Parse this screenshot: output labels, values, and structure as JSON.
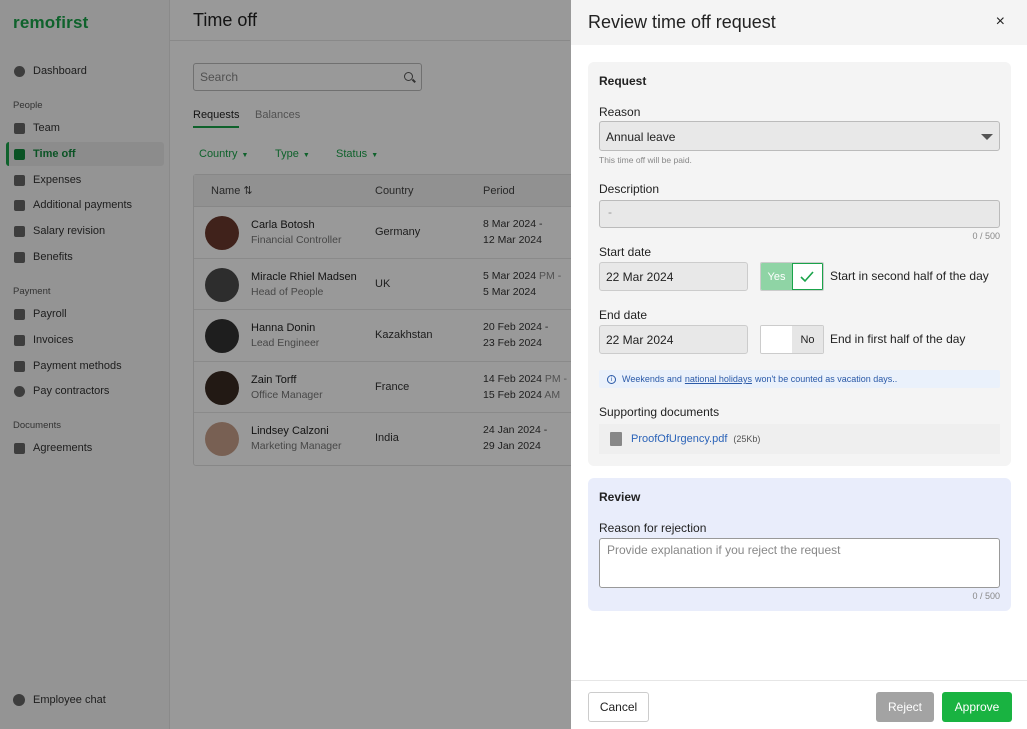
{
  "app": {
    "logo": "remofirst"
  },
  "sidebar": {
    "top": [
      {
        "label": "Dashboard",
        "icon": "dashboard-icon"
      }
    ],
    "people_header": "People",
    "people": [
      {
        "label": "Team",
        "icon": "team-icon"
      },
      {
        "label": "Time off",
        "icon": "calendar-icon",
        "active": true
      },
      {
        "label": "Expenses",
        "icon": "receipt-icon"
      },
      {
        "label": "Additional payments",
        "icon": "receipt-icon"
      },
      {
        "label": "Salary revision",
        "icon": "salary-icon"
      },
      {
        "label": "Benefits",
        "icon": "gift-icon"
      }
    ],
    "payment_header": "Payment",
    "payment": [
      {
        "label": "Payroll",
        "icon": "payroll-icon"
      },
      {
        "label": "Invoices",
        "icon": "invoice-icon"
      },
      {
        "label": "Payment methods",
        "icon": "card-icon"
      },
      {
        "label": "Pay contractors",
        "icon": "dollar-icon"
      }
    ],
    "documents_header": "Documents",
    "documents": [
      {
        "label": "Agreements",
        "icon": "document-icon"
      }
    ],
    "chat": "Employee chat"
  },
  "main": {
    "title": "Time off",
    "search_placeholder": "Search",
    "tabs": [
      "Requests",
      "Balances"
    ],
    "filters": [
      "Country",
      "Type",
      "Status"
    ],
    "columns": {
      "name": "Name ⇅",
      "country": "Country",
      "period": "Period"
    },
    "rows": [
      {
        "name": "Carla Botosh",
        "role": "Financial Controller",
        "country": "Germany",
        "start": "8 Mar 2024 -",
        "start_half": "",
        "end": "12 Mar 2024",
        "end_half": ""
      },
      {
        "name": "Miracle Rhiel Madsen",
        "role": "Head of People",
        "country": "UK",
        "start": "5 Mar 2024",
        "start_half": "PM -",
        "end": "5 Mar 2024",
        "end_half": ""
      },
      {
        "name": "Hanna Donin",
        "role": "Lead Engineer",
        "country": "Kazakhstan",
        "start": "20 Feb 2024 -",
        "start_half": "",
        "end": "23 Feb 2024",
        "end_half": ""
      },
      {
        "name": "Zain Torff",
        "role": "Office Manager",
        "country": "France",
        "start": "14 Feb 2024",
        "start_half": "PM -",
        "end": "15 Feb 2024",
        "end_half": "AM"
      },
      {
        "name": "Lindsey Calzoni",
        "role": "Marketing Manager",
        "country": "India",
        "start": "24 Jan 2024 -",
        "start_half": "",
        "end": "29 Jan 2024",
        "end_half": ""
      }
    ],
    "avatar_colors": [
      "#6b3a2e",
      "#4b4b4b",
      "#333333",
      "#3a2a22",
      "#c9a08a"
    ]
  },
  "panel": {
    "title": "Review time off request",
    "close_label": "×",
    "request": {
      "title": "Request",
      "reason_label": "Reason",
      "reason_value": "Annual leave",
      "reason_hint": "This time off will be paid.",
      "description_label": "Description",
      "description_value": "-",
      "description_counter": "0 / 500",
      "start_label": "Start date",
      "start_value": "22 Mar 2024",
      "start_toggle_yes": "Yes",
      "start_toggle_label": "Start in second half of the day",
      "end_label": "End date",
      "end_value": "22 Mar 2024",
      "end_toggle_no": "No",
      "end_toggle_label": "End in first half of the day",
      "info_prefix": "Weekends and",
      "info_link": "national holidays",
      "info_suffix": "won't be counted as vacation days..",
      "docs_label": "Supporting documents",
      "doc_name": "ProofOfUrgency.pdf",
      "doc_size": "(25Kb)"
    },
    "review": {
      "title": "Review",
      "rejection_label": "Reason for rejection",
      "rejection_placeholder": "Provide explanation if you reject the request",
      "rejection_counter": "0 / 500"
    },
    "footer": {
      "cancel": "Cancel",
      "reject": "Reject",
      "approve": "Approve"
    }
  },
  "colors": {
    "brand": "#1aa34a",
    "approve": "#19b341",
    "reject": "#a3a3a3",
    "review_bg": "#e9edfb"
  }
}
